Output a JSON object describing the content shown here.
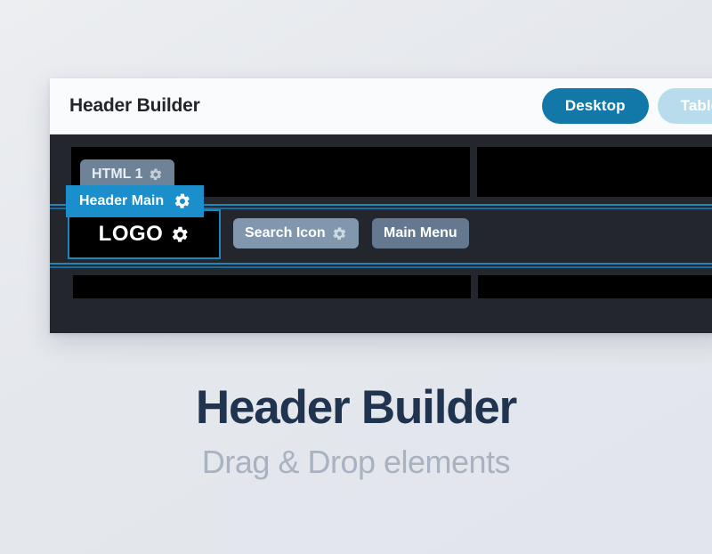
{
  "builder": {
    "title": "Header Builder",
    "devices": [
      {
        "label": "Desktop",
        "state": "active"
      },
      {
        "label": "Tablet",
        "state": "inactive"
      }
    ],
    "module_tab": {
      "label": "Header Main",
      "icon": "gear-icon"
    },
    "elements": {
      "html_chip": {
        "label": "HTML 1",
        "icon": "gear-icon"
      },
      "logo": {
        "label": "LOGO",
        "icon": "gear-icon"
      },
      "search": {
        "label": "Search Icon",
        "icon": "gear-icon"
      },
      "menu": {
        "label": "Main Menu"
      }
    }
  },
  "caption": {
    "title": "Header Builder",
    "subtitle": "Drag & Drop elements"
  },
  "colors": {
    "accent_blue": "#1278a8",
    "tab_blue": "#1b8fcc",
    "selection_blue": "#1b87bd",
    "inactive_pill": "#b9dcec",
    "canvas_dark": "#23272d",
    "cell_black": "#000000",
    "title_navy": "#20344f",
    "subtitle_gray": "#a8b2c0",
    "page_background": "#e5e8ed"
  }
}
